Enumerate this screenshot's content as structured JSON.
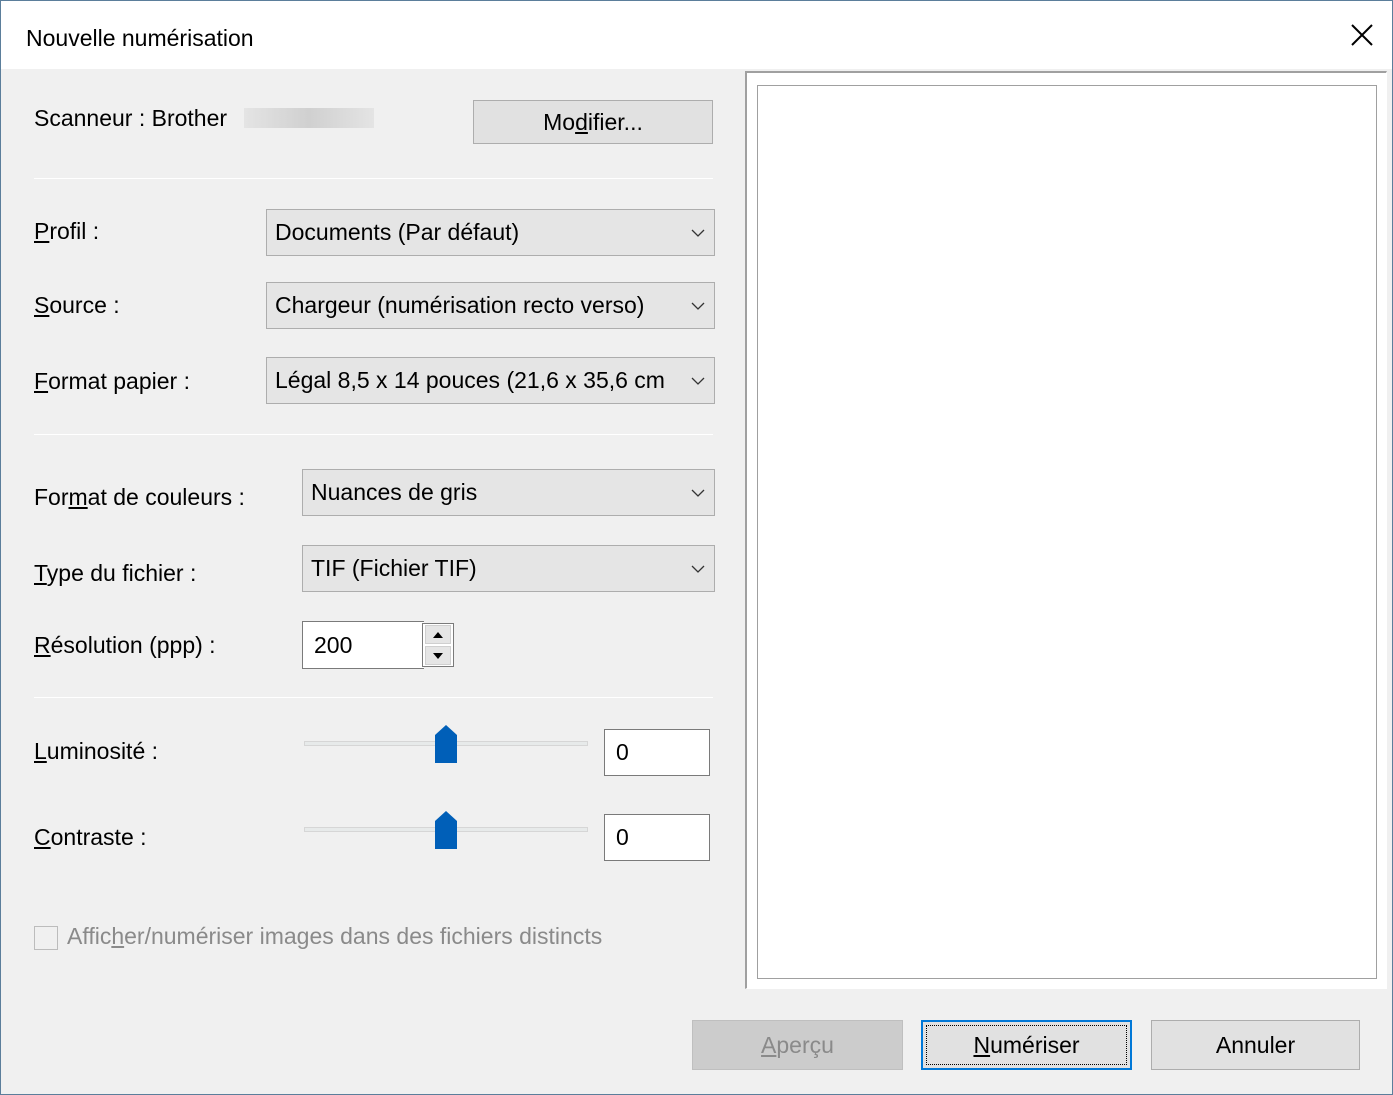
{
  "window": {
    "title": "Nouvelle numérisation"
  },
  "scanner": {
    "label": "Scanneur : Brother",
    "modify_button": {
      "pre": "Mo",
      "key": "d",
      "post": "ifier..."
    }
  },
  "profile": {
    "key": "P",
    "rest": "rofil :",
    "value": "Documents (Par défaut)"
  },
  "source": {
    "key": "S",
    "rest": "ource :",
    "value": "Chargeur (numérisation recto verso)"
  },
  "paper": {
    "key": "F",
    "rest": "ormat papier :",
    "value": "Légal 8,5 x 14 pouces (21,6 x 35,6 cm"
  },
  "color": {
    "pre": "For",
    "key": "m",
    "post": "at de couleurs :",
    "value": "Nuances de gris"
  },
  "filetype": {
    "key": "T",
    "rest": "ype du fichier :",
    "value": "TIF (Fichier TIF)"
  },
  "resolution": {
    "key": "R",
    "rest": "ésolution (ppp) :",
    "value": "200"
  },
  "brightness": {
    "key": "L",
    "rest": "uminosité :",
    "value": "0",
    "level": 0.5
  },
  "contrast": {
    "key": "C",
    "rest": "ontraste :",
    "value": "0",
    "level": 0.5
  },
  "separate_files": {
    "pre": "Affic",
    "key": "h",
    "post": "er/numériser images dans des fichiers distincts",
    "checked": false
  },
  "buttons": {
    "preview": {
      "key": "A",
      "rest": "perçu"
    },
    "scan": {
      "key": "N",
      "rest": "umériser"
    },
    "cancel": "Annuler"
  },
  "colors": {
    "accent": "#0078d7",
    "thumb": "#005fb8",
    "dialog_bg": "#f0f0f0"
  },
  "icons": {
    "close": "close-icon",
    "dropdown": "chevron-down-icon",
    "spin_up": "arrow-up-icon",
    "spin_down": "arrow-down-icon"
  }
}
